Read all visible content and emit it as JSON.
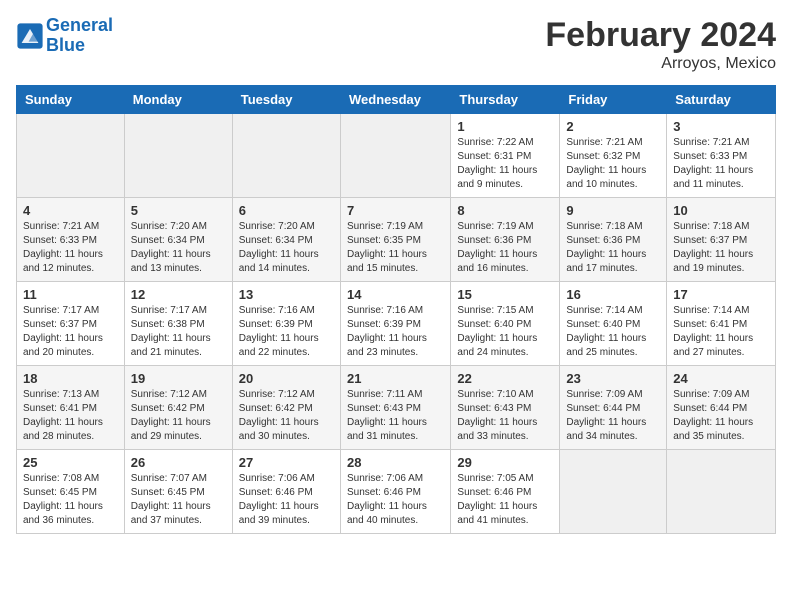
{
  "header": {
    "logo_line1": "General",
    "logo_line2": "Blue",
    "month_title": "February 2024",
    "subtitle": "Arroyos, Mexico"
  },
  "days_of_week": [
    "Sunday",
    "Monday",
    "Tuesday",
    "Wednesday",
    "Thursday",
    "Friday",
    "Saturday"
  ],
  "weeks": [
    [
      {
        "day": "",
        "empty": true
      },
      {
        "day": "",
        "empty": true
      },
      {
        "day": "",
        "empty": true
      },
      {
        "day": "",
        "empty": true
      },
      {
        "day": "1",
        "sunrise": "7:22 AM",
        "sunset": "6:31 PM",
        "daylight": "11 hours and 9 minutes."
      },
      {
        "day": "2",
        "sunrise": "7:21 AM",
        "sunset": "6:32 PM",
        "daylight": "11 hours and 10 minutes."
      },
      {
        "day": "3",
        "sunrise": "7:21 AM",
        "sunset": "6:33 PM",
        "daylight": "11 hours and 11 minutes."
      }
    ],
    [
      {
        "day": "4",
        "sunrise": "7:21 AM",
        "sunset": "6:33 PM",
        "daylight": "11 hours and 12 minutes."
      },
      {
        "day": "5",
        "sunrise": "7:20 AM",
        "sunset": "6:34 PM",
        "daylight": "11 hours and 13 minutes."
      },
      {
        "day": "6",
        "sunrise": "7:20 AM",
        "sunset": "6:34 PM",
        "daylight": "11 hours and 14 minutes."
      },
      {
        "day": "7",
        "sunrise": "7:19 AM",
        "sunset": "6:35 PM",
        "daylight": "11 hours and 15 minutes."
      },
      {
        "day": "8",
        "sunrise": "7:19 AM",
        "sunset": "6:36 PM",
        "daylight": "11 hours and 16 minutes."
      },
      {
        "day": "9",
        "sunrise": "7:18 AM",
        "sunset": "6:36 PM",
        "daylight": "11 hours and 17 minutes."
      },
      {
        "day": "10",
        "sunrise": "7:18 AM",
        "sunset": "6:37 PM",
        "daylight": "11 hours and 19 minutes."
      }
    ],
    [
      {
        "day": "11",
        "sunrise": "7:17 AM",
        "sunset": "6:37 PM",
        "daylight": "11 hours and 20 minutes."
      },
      {
        "day": "12",
        "sunrise": "7:17 AM",
        "sunset": "6:38 PM",
        "daylight": "11 hours and 21 minutes."
      },
      {
        "day": "13",
        "sunrise": "7:16 AM",
        "sunset": "6:39 PM",
        "daylight": "11 hours and 22 minutes."
      },
      {
        "day": "14",
        "sunrise": "7:16 AM",
        "sunset": "6:39 PM",
        "daylight": "11 hours and 23 minutes."
      },
      {
        "day": "15",
        "sunrise": "7:15 AM",
        "sunset": "6:40 PM",
        "daylight": "11 hours and 24 minutes."
      },
      {
        "day": "16",
        "sunrise": "7:14 AM",
        "sunset": "6:40 PM",
        "daylight": "11 hours and 25 minutes."
      },
      {
        "day": "17",
        "sunrise": "7:14 AM",
        "sunset": "6:41 PM",
        "daylight": "11 hours and 27 minutes."
      }
    ],
    [
      {
        "day": "18",
        "sunrise": "7:13 AM",
        "sunset": "6:41 PM",
        "daylight": "11 hours and 28 minutes."
      },
      {
        "day": "19",
        "sunrise": "7:12 AM",
        "sunset": "6:42 PM",
        "daylight": "11 hours and 29 minutes."
      },
      {
        "day": "20",
        "sunrise": "7:12 AM",
        "sunset": "6:42 PM",
        "daylight": "11 hours and 30 minutes."
      },
      {
        "day": "21",
        "sunrise": "7:11 AM",
        "sunset": "6:43 PM",
        "daylight": "11 hours and 31 minutes."
      },
      {
        "day": "22",
        "sunrise": "7:10 AM",
        "sunset": "6:43 PM",
        "daylight": "11 hours and 33 minutes."
      },
      {
        "day": "23",
        "sunrise": "7:09 AM",
        "sunset": "6:44 PM",
        "daylight": "11 hours and 34 minutes."
      },
      {
        "day": "24",
        "sunrise": "7:09 AM",
        "sunset": "6:44 PM",
        "daylight": "11 hours and 35 minutes."
      }
    ],
    [
      {
        "day": "25",
        "sunrise": "7:08 AM",
        "sunset": "6:45 PM",
        "daylight": "11 hours and 36 minutes."
      },
      {
        "day": "26",
        "sunrise": "7:07 AM",
        "sunset": "6:45 PM",
        "daylight": "11 hours and 37 minutes."
      },
      {
        "day": "27",
        "sunrise": "7:06 AM",
        "sunset": "6:46 PM",
        "daylight": "11 hours and 39 minutes."
      },
      {
        "day": "28",
        "sunrise": "7:06 AM",
        "sunset": "6:46 PM",
        "daylight": "11 hours and 40 minutes."
      },
      {
        "day": "29",
        "sunrise": "7:05 AM",
        "sunset": "6:46 PM",
        "daylight": "11 hours and 41 minutes."
      },
      {
        "day": "",
        "empty": true
      },
      {
        "day": "",
        "empty": true
      }
    ]
  ]
}
